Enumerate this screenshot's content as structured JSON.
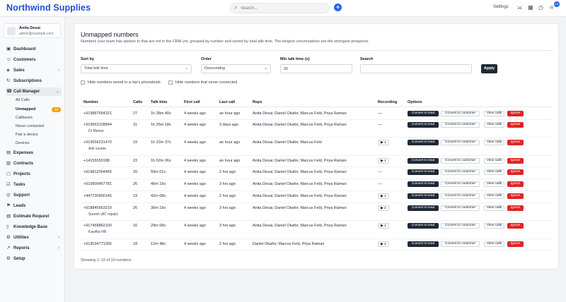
{
  "app": {
    "brand": "Northwind Supplies",
    "search_placeholder": "Search...",
    "settings_label": "Settings",
    "notification_count": "11"
  },
  "user": {
    "name": "Anita Desai",
    "email": "admin@example.com"
  },
  "sidebar": {
    "items": [
      {
        "label": "Dashboard",
        "icon": "dashboard-icon"
      },
      {
        "label": "Customers",
        "icon": "users-icon"
      },
      {
        "label": "Sales",
        "icon": "tag-icon",
        "has_children": true
      },
      {
        "label": "Subscriptions",
        "icon": "refresh-icon"
      },
      {
        "label": "Call Manager",
        "icon": "phone-icon",
        "has_children": true,
        "expanded": true
      },
      {
        "label": "Expenses",
        "icon": "file-icon"
      },
      {
        "label": "Contracts",
        "icon": "contract-icon"
      },
      {
        "label": "Projects",
        "icon": "briefcase-icon"
      },
      {
        "label": "Tasks",
        "icon": "check-icon"
      },
      {
        "label": "Support",
        "icon": "support-icon"
      },
      {
        "label": "Leads",
        "icon": "leads-icon"
      },
      {
        "label": "Estimate Request",
        "icon": "estimate-icon"
      },
      {
        "label": "Knowledge Base",
        "icon": "book-icon"
      },
      {
        "label": "Utilities",
        "icon": "gear-icon",
        "has_children": true
      },
      {
        "label": "Reports",
        "icon": "chart-icon",
        "has_children": true
      },
      {
        "label": "Setup",
        "icon": "settings-icon"
      }
    ],
    "call_manager_children": [
      {
        "label": "All Calls"
      },
      {
        "label": "Unmapped",
        "badge": "10",
        "current": true
      },
      {
        "label": "Callbacks"
      },
      {
        "label": "Never contacted"
      },
      {
        "label": "Pair a device"
      },
      {
        "label": "Devices"
      }
    ]
  },
  "page": {
    "title": "Unmapped numbers",
    "description": "Numbers your team has spoken to that are not in the CRM yet, grouped by number and sorted by total talk time. The longest conversations are the strongest prospects."
  },
  "filters": {
    "sort_by_label": "Sort by",
    "sort_by_value": "Total talk time",
    "order_label": "Order",
    "order_value": "Descending",
    "min_talk_label": "Min talk time (s)",
    "min_talk_value": "20",
    "search_label": "Search",
    "search_value": "",
    "apply_label": "Apply",
    "hide_phonebook_label": "Hide numbers saved in a rep's phonebook",
    "hide_never_connected_label": "Hide numbers that never connected"
  },
  "table": {
    "headers": {
      "number": "Number",
      "calls": "Calls",
      "talk": "Talk time",
      "first": "First call",
      "last": "Last call",
      "reps": "Reps",
      "recording": "Recording",
      "options": "Options"
    },
    "actions": {
      "lead": "Convert to lead",
      "customer": "Convert to customer",
      "view": "View calls",
      "ignore": "Ignore"
    },
    "rows": [
      {
        "number": "+919887654321",
        "name": "",
        "calls": "27",
        "talk": "1h 38m 40s",
        "first": "4 weeks ago",
        "last": "an hour ago",
        "reps": "Anita Desai, Daniel Okafor, Marcus Feld, Priya Raman",
        "recording": "—"
      },
      {
        "number": "+919663128844",
        "name": "Dr Menon",
        "calls": "31",
        "talk": "1h 35m 18s",
        "first": "4 weeks ago",
        "last": "3 days ago",
        "reps": "Anita Desai, Daniel Okafor, Marcus Feld, Priya Raman",
        "recording": "—"
      },
      {
        "number": "+919556231470",
        "name": "Anil courier",
        "calls": "19",
        "talk": "1h 22m 37s",
        "first": "4 weeks ago",
        "last": "an hour ago",
        "reps": "Anita Desai, Daniel Okafor, Marcus Feld",
        "recording": "1"
      },
      {
        "number": "+14155550188",
        "name": "",
        "calls": "23",
        "talk": "1h 02m 06s",
        "first": "4 weeks ago",
        "last": "an hour ago",
        "reps": "Anita Desai, Daniel Okafor, Marcus Feld, Priya Raman",
        "recording": "1"
      },
      {
        "number": "+919812004455",
        "name": "",
        "calls": "20",
        "talk": "59m 01s",
        "first": "4 weeks ago",
        "last": "2 hrs ago",
        "reps": "Anita Desai, Daniel Okafor, Marcus Feld, Priya Raman",
        "recording": "—"
      },
      {
        "number": "+919900457781",
        "name": "",
        "calls": "26",
        "talk": "46m 19s",
        "first": "4 weeks ago",
        "last": "3 hrs ago",
        "reps": "Anita Desai, Daniel Okafor, Marcus Feld, Priya Raman",
        "recording": "—"
      },
      {
        "number": "+447700900145",
        "name": "",
        "calls": "19",
        "talk": "42m 08s",
        "first": "4 weeks ago",
        "last": "2 hrs ago",
        "reps": "Anita Desai, Daniel Okafor, Marcus Feld, Priya Raman",
        "recording": "1"
      },
      {
        "number": "+918845663210",
        "name": "Suresh (AC repair)",
        "calls": "26",
        "talk": "36m 19s",
        "first": "4 weeks ago",
        "last": "3 hrs ago",
        "reps": "Anita Desai, Daniel Okafor, Marcus Feld, Priya Raman",
        "recording": "2"
      },
      {
        "number": "+917458862100",
        "name": "Kavitha HR",
        "calls": "16",
        "talk": "29m 08s",
        "first": "4 weeks ago",
        "last": "3 hrs ago",
        "reps": "Anita Desai, Daniel Okafor, Marcus Feld, Priya Raman",
        "recording": "1"
      },
      {
        "number": "+919034771265",
        "name": "",
        "calls": "18",
        "talk": "12m 48s",
        "first": "4 weeks ago",
        "last": "2 hrs ago",
        "reps": "Daniel Okafor, Marcus Feld, Priya Raman",
        "recording": "2"
      }
    ]
  },
  "footer": {
    "summary": "Showing 1–10 of 10 numbers"
  },
  "colors": {
    "brand": "#1d4ed8",
    "dark_button": "#1f2937",
    "ignore": "#dc2626",
    "badge": "#f59e0b"
  }
}
